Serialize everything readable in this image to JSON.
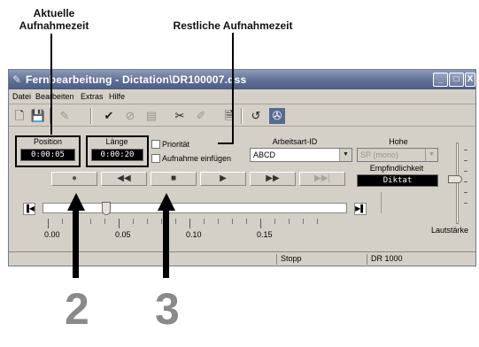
{
  "callouts": {
    "aktuelle": "Aktuelle\nAufnahmezeit",
    "restliche": "Restliche Aufnahmezeit",
    "numbers": [
      "2",
      "3"
    ]
  },
  "window": {
    "title": "Fernbearbeitung - Dictation\\DR100007.dss",
    "controls": [
      "_",
      "□",
      "X"
    ]
  },
  "menu": [
    "Datei",
    "Bearbeiten",
    "Extras",
    "Hilfe"
  ],
  "toolbar": {
    "icons": [
      "new-file-icon",
      "save-icon",
      "dictate-icon",
      "check-icon",
      "circle-check-icon",
      "book-icon",
      "cut-icon",
      "edit-icon",
      "document-icon",
      "undo-icon",
      "settings-icon"
    ],
    "glyphs": [
      "🗋",
      "💾",
      "✎",
      "✔",
      "⊘",
      "▤",
      "✂",
      "✐",
      "🗎",
      "↺",
      "✇"
    ]
  },
  "fields": {
    "position_label": "Position",
    "position_value": "0:00:05",
    "laenge_label": "Länge",
    "laenge_value": "0:00:20",
    "prioritaet_label": "Priorität",
    "aufnahme_einfuegen_label": "Aufnahme einfügen",
    "arbeitsart_label": "Arbeitsart-ID",
    "arbeitsart_value": "ABCD",
    "hohe_label": "Hohe",
    "hohe_value": "SP (mono)",
    "empfindlichkeit_label": "Empfindlichkeit",
    "empfindlichkeit_value": "Diktat",
    "lautstaerke_label": "Lautstärke"
  },
  "transport": {
    "record": "●",
    "rewind": "◀◀",
    "stop": "■",
    "play": "▶",
    "fast_forward": "▶▶",
    "skip_end": "▶▶|"
  },
  "slider": {
    "position_fraction": 0.2,
    "nav_start": "▐◀",
    "nav_end": "▶▌"
  },
  "ruler": [
    "0.00",
    "0.05",
    "0.10",
    "0.15"
  ],
  "volume_level": 0.55,
  "status": {
    "cell1": "",
    "cell2": "Stopp",
    "cell3": "DR 1000"
  }
}
